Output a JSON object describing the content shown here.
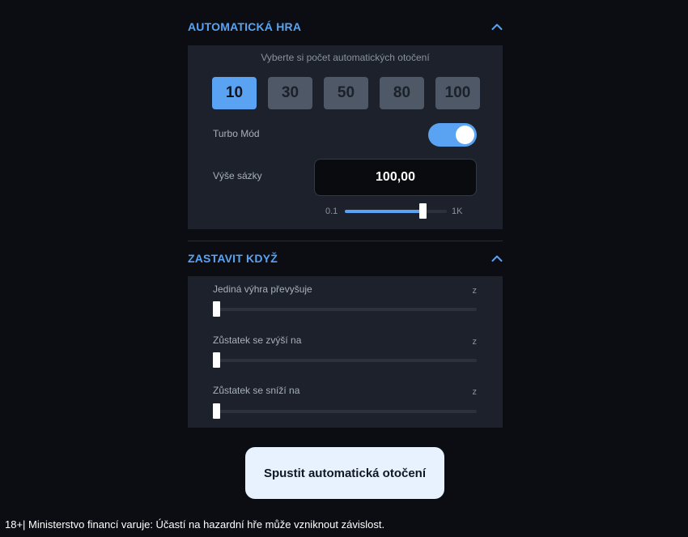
{
  "autoplay": {
    "title": "AUTOMATICKÁ HRA",
    "subtitle": "Vyberte si počet automatických otočení",
    "counts": [
      "10",
      "30",
      "50",
      "80",
      "100"
    ],
    "selected_count": "10",
    "turbo_label": "Turbo Mód",
    "turbo_on": true,
    "bet_label": "Výše sázky",
    "bet_value": "100,00",
    "range_min": "0.1",
    "range_max": "1K",
    "bet_slider_fraction": 0.76
  },
  "stop": {
    "title": "ZASTAVIT KDYŽ",
    "items": [
      {
        "label": "Jediná výhra převyšuje",
        "unit": "z",
        "slider_fraction": 0
      },
      {
        "label": "Zůstatek se zvýší na",
        "unit": "z",
        "slider_fraction": 0
      },
      {
        "label": "Zůstatek se sníží na",
        "unit": "z",
        "slider_fraction": 0
      }
    ]
  },
  "start_button_label": "Spustit automatická otočení",
  "footer_text": "18+| Ministerstvo financí varuje: Účastí na hazardní hře může vzniknout závislost.",
  "colors": {
    "accent": "#5aa3f2",
    "background": "#0b0d12",
    "panel": "#1c212b"
  },
  "icons": {
    "collapse": "chevron-up-icon"
  }
}
